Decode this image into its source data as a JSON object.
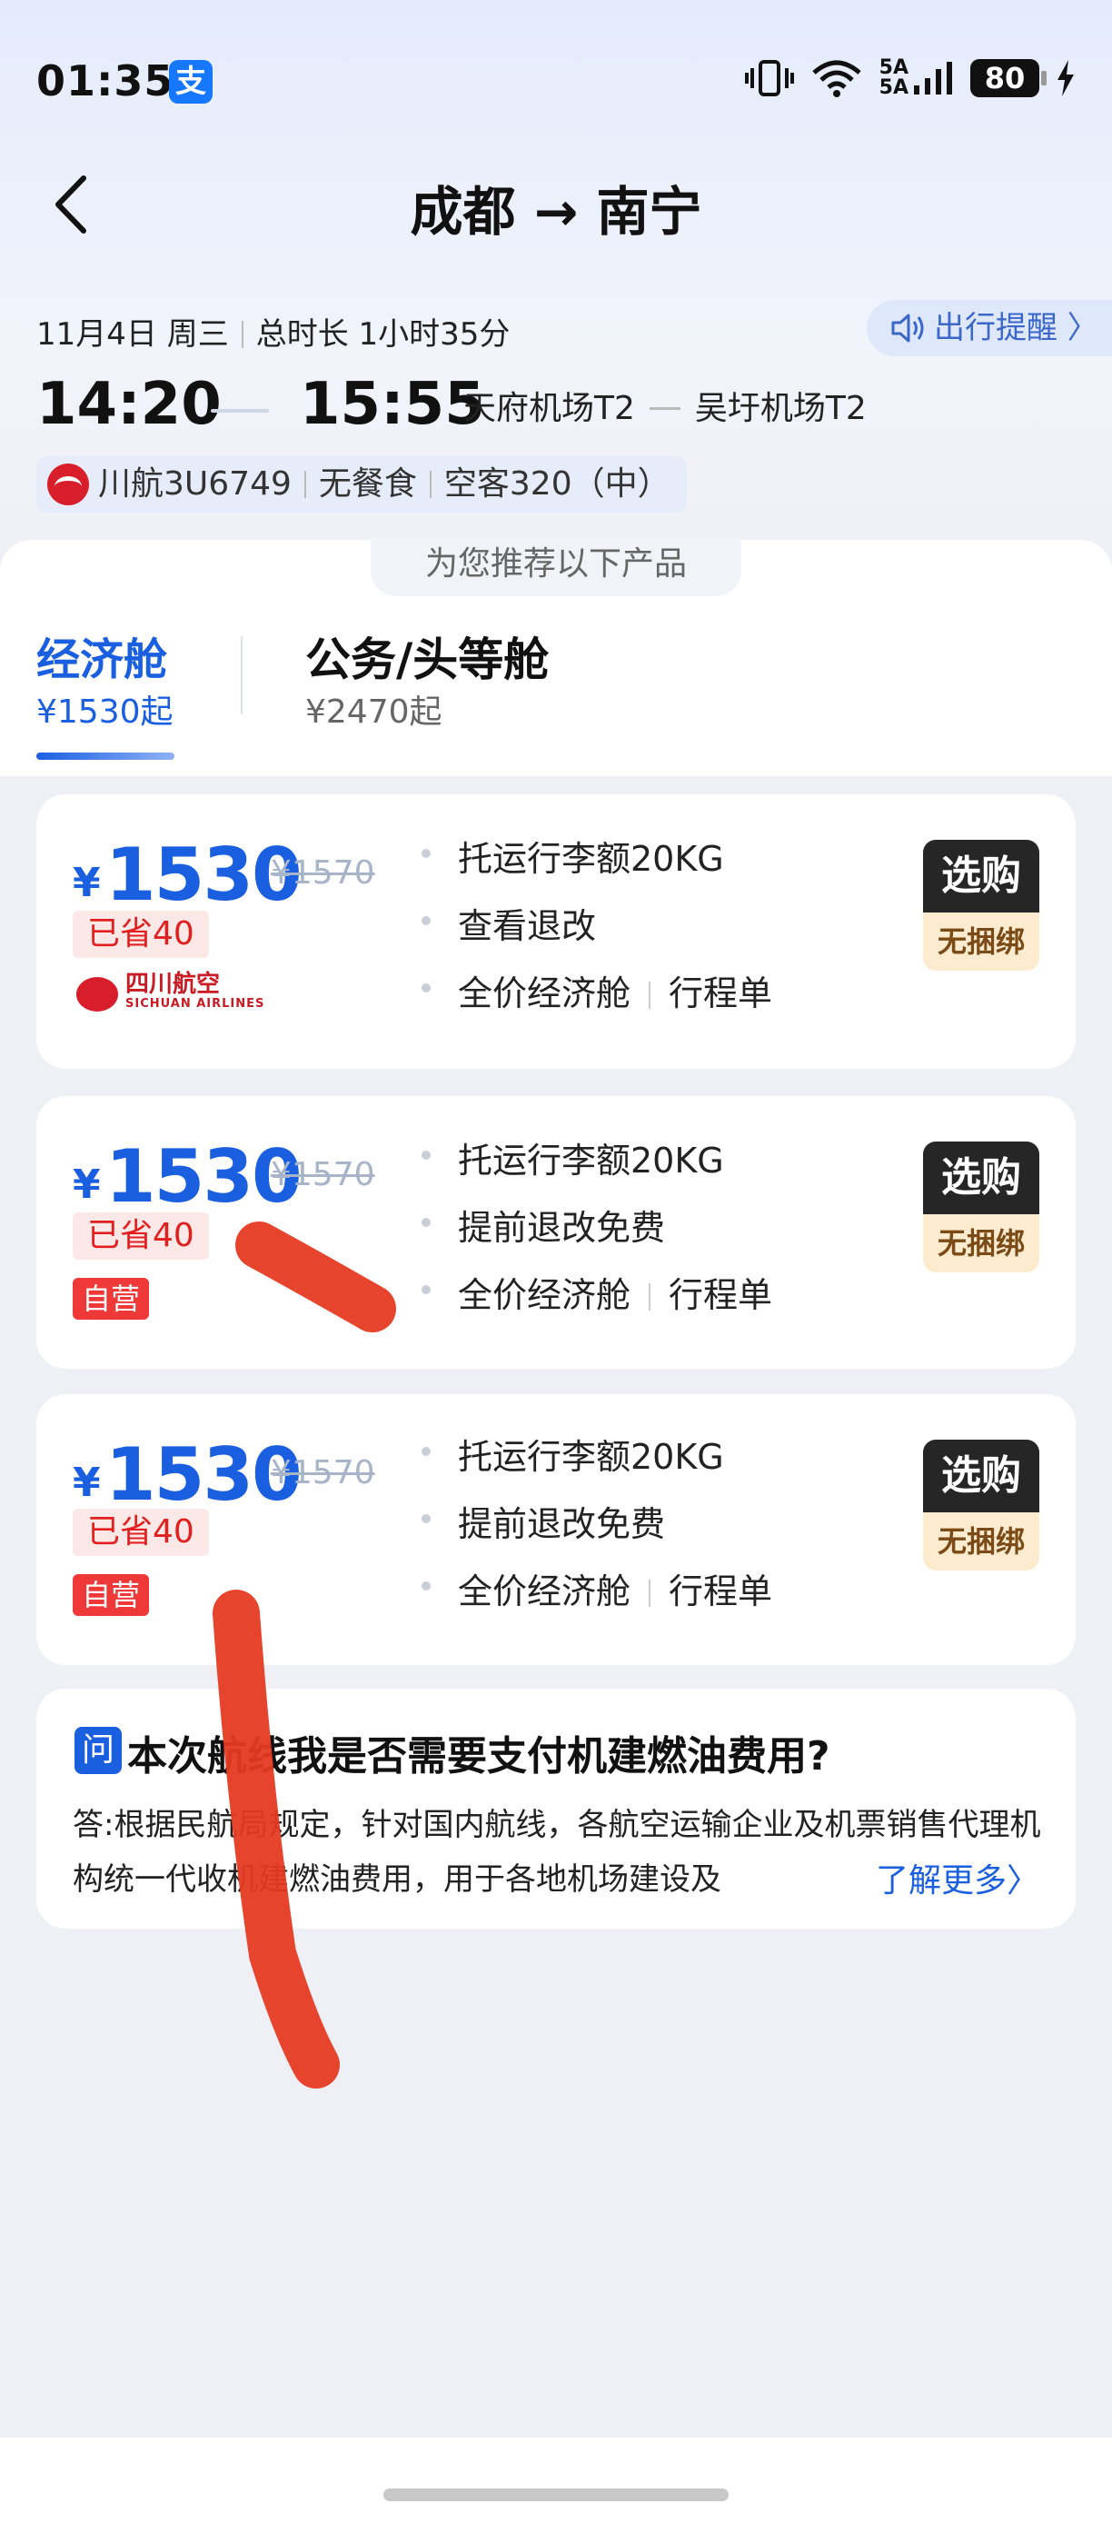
{
  "status_bar": {
    "time": "01:35",
    "app_badge": "支",
    "network_label": "5A",
    "battery": "80"
  },
  "header": {
    "title": "成都 → 南宁"
  },
  "flight": {
    "date": "11月4日 周三",
    "duration": "总时长 1小时35分",
    "reminder": "出行提醒 〉",
    "depart_time": "14:20",
    "arrive_time": "15:55",
    "depart_airport": "天府机场T2",
    "arrive_airport": "吴圩机场T2",
    "flight_no": "川航3U6749",
    "meal": "无餐食",
    "aircraft": "空客320（中）"
  },
  "recommend_label": "为您推荐以下产品",
  "tabs": [
    {
      "label": "经济舱",
      "price": "¥1530起",
      "active": true
    },
    {
      "label": "公务/头等舱",
      "price": "¥2470起",
      "active": false
    }
  ],
  "products": [
    {
      "currency": "¥",
      "price": "1530",
      "old_price": "¥1570",
      "saved": "已省40",
      "brand": "四川航空",
      "brand_en": "SICHUAN AIRLINES",
      "features": [
        "托运行李额20KG",
        "查看退改",
        "全价经济舱"
      ],
      "extra": "行程单",
      "buy": "选购",
      "buy_sub": "无捆绑"
    },
    {
      "currency": "¥",
      "price": "1530",
      "old_price": "¥1570",
      "saved": "已省40",
      "tag": "自营",
      "features": [
        "托运行李额20KG",
        "提前退改免费",
        "全价经济舱"
      ],
      "extra": "行程单",
      "buy": "选购",
      "buy_sub": "无捆绑"
    },
    {
      "currency": "¥",
      "price": "1530",
      "old_price": "¥1570",
      "saved": "已省40",
      "tag": "自营",
      "features": [
        "托运行李额20KG",
        "提前退改免费",
        "全价经济舱"
      ],
      "extra": "行程单",
      "buy": "选购",
      "buy_sub": "无捆绑"
    }
  ],
  "faq": {
    "icon": "问",
    "question": "本次航线我是否需要支付机建燃油费用?",
    "answer": "答:根据民航局规定，针对国内航线，各航空运输企业及机票销售代理机构统一代收机建燃油费用，用于各地机场建设及",
    "more": "了解更多〉"
  },
  "colors": {
    "accent": "#1a5fe0",
    "discount_red": "#e21f1f",
    "annotation": "#e63a23"
  }
}
